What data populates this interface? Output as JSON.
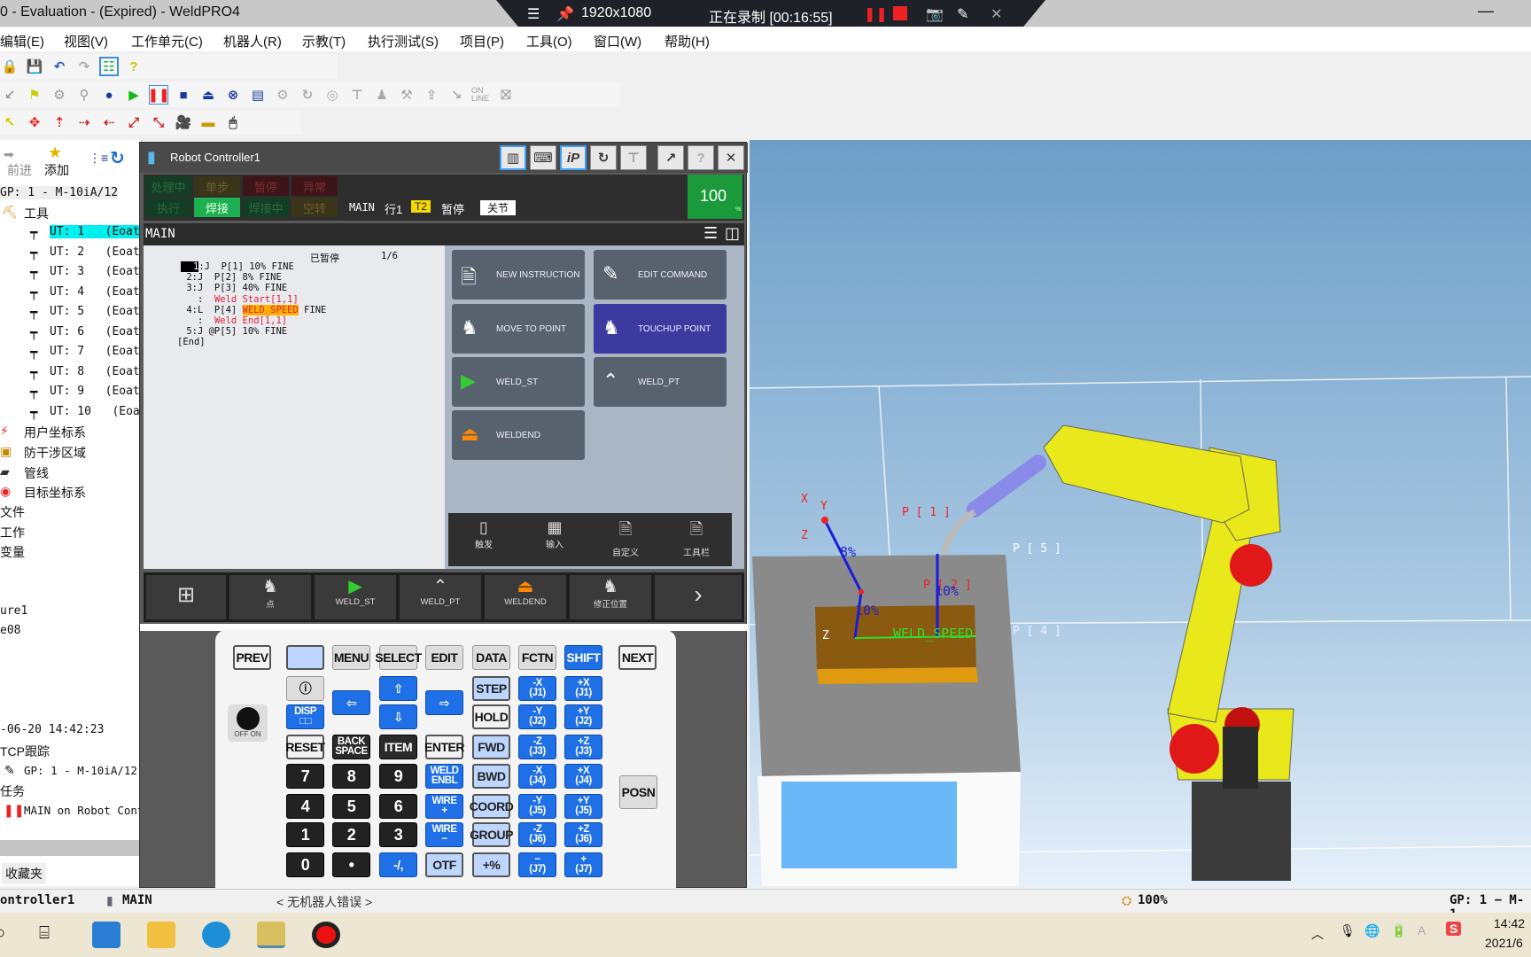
{
  "window": {
    "title": "0 - Evaluation - (Expired) - WeldPRO4",
    "minimize": "—"
  },
  "recorder": {
    "resolution": "1920x1080",
    "status": "正在录制 [00:16:55]"
  },
  "menu": [
    "编辑(E)",
    "视图(V)",
    "工作单元(C)",
    "机器人(R)",
    "示教(T)",
    "执行测试(S)",
    "项目(P)",
    "工具(O)",
    "窗口(W)",
    "帮助(H)"
  ],
  "toolbar": {
    "online_label": "ON LINE"
  },
  "left_panel": {
    "forward": "前进",
    "add": "添加",
    "group": "GP: 1 - M-10iA/12",
    "tools": "工具",
    "ut": [
      [
        "UT: 1",
        "(Eoat1"
      ],
      [
        "UT: 2",
        "(Eoat2"
      ],
      [
        "UT: 3",
        "(Eoat3"
      ],
      [
        "UT: 4",
        "(Eoat4"
      ],
      [
        "UT: 5",
        "(Eoat5"
      ],
      [
        "UT: 6",
        "(Eoat6"
      ],
      [
        "UT: 7",
        "(Eoat7"
      ],
      [
        "UT: 8",
        "(Eoat8"
      ],
      [
        "UT: 9",
        "(Eoat9"
      ],
      [
        "UT: 10",
        "(Eoat"
      ]
    ],
    "nodes": [
      "用户坐标系",
      "防干涉区域",
      "管线",
      "目标坐标系",
      "文件",
      "工作",
      "变量"
    ],
    "lower": [
      "ure1",
      "e08",
      "-06-20 14:42:23",
      "TCP跟踪",
      "GP: 1 - M-10iA/12 (Robot Con",
      "任务",
      "MAIN on Robot Controller1"
    ],
    "favorites_tab": "收藏夹"
  },
  "tp": {
    "title": "Robot Controller1",
    "leds_top": [
      "处理中",
      "单步",
      "暂停",
      "异常"
    ],
    "leds_bottom": [
      "执行",
      "焊接",
      "焊接中",
      "空转"
    ],
    "status_line": {
      "prog": "MAIN",
      "line": "行1",
      "mode": "T2",
      "state": "暂停",
      "coord": "关节"
    },
    "override": "100",
    "override_unit": "%",
    "screen_title": "MAIN",
    "paused": "已暂停",
    "position": "1/6",
    "program": [
      [
        {
          "t": "1",
          "c": "cur"
        },
        {
          "t": ":J  P[1] 10% FINE",
          "c": "n"
        }
      ],
      [
        {
          "t": " 2:J  P[2] 8% FINE",
          "c": "n"
        }
      ],
      [
        {
          "t": " 3:J  P[3] 40% FINE",
          "c": "n"
        }
      ],
      [
        {
          "t": "   :  ",
          "c": "n"
        },
        {
          "t": "Weld Start",
          "c": "r"
        },
        {
          "t": "[1,1]",
          "c": "r"
        }
      ],
      [
        {
          "t": " 4:L  P[4] ",
          "c": "n"
        },
        {
          "t": "WELD_SPEED",
          "c": "h"
        },
        {
          "t": " FINE",
          "c": "n"
        }
      ],
      [
        {
          "t": "   :  ",
          "c": "n"
        },
        {
          "t": "Weld End",
          "c": "r"
        },
        {
          "t": "[1,1]",
          "c": "r"
        }
      ],
      [
        {
          "t": " 5:J @P[5] 10% FINE",
          "c": "n"
        }
      ],
      [
        {
          "t": "[End]",
          "c": "n"
        }
      ]
    ],
    "instr_buttons": [
      "NEW INSTRUCTION",
      "EDIT COMMAND",
      "MOVE TO POINT",
      "TOUCHUP POINT",
      "WELD_ST",
      "WELD_PT",
      "WELDEND"
    ],
    "sub_tools": [
      "触发",
      "输入",
      "自定义",
      "工具栏"
    ],
    "func_bar": [
      "",
      "点",
      "WELD_ST",
      "WELD_PT",
      "WELDEND",
      "修正位置",
      ""
    ],
    "keypad_side": {
      "prev": "PREV",
      "next": "NEXT",
      "posn": "POSN",
      "switch": "OFF  ON"
    },
    "keys": [
      [
        [
          "",
          "lblue"
        ],
        [
          "MENU",
          "gray"
        ],
        [
          "SELECT",
          "gray"
        ],
        [
          "EDIT",
          "gray"
        ],
        [
          "DATA",
          "gray"
        ],
        [
          "FCTN",
          "gray"
        ],
        [
          "SHIFT",
          "blue"
        ]
      ],
      [
        [
          "ⓘ",
          "gray"
        ],
        [
          "⇦",
          "blue"
        ],
        [
          "⇧",
          "blue"
        ],
        [
          "⇨",
          "blue"
        ],
        [
          "STEP",
          "lblue"
        ],
        [
          "-X\n(J1)",
          "blue"
        ],
        [
          "+X\n(J1)",
          "blue"
        ]
      ],
      [
        [
          "DISP\n□□",
          "blue"
        ],
        null,
        [
          "⇩",
          "blue"
        ],
        null,
        [
          "HOLD",
          "white"
        ],
        [
          "-Y\n(J2)",
          "blue"
        ],
        [
          "+Y\n(J2)",
          "blue"
        ]
      ],
      [
        [
          "RESET",
          "white"
        ],
        [
          "BACK\nSPACE",
          "black"
        ],
        [
          "ITEM",
          "black"
        ],
        [
          "ENTER",
          "white"
        ],
        [
          "FWD",
          "lblue"
        ],
        [
          "-Z\n(J3)",
          "blue"
        ],
        [
          "+Z\n(J3)",
          "blue"
        ]
      ],
      [
        [
          "7",
          "num"
        ],
        [
          "8",
          "num"
        ],
        [
          "9",
          "num"
        ],
        [
          "WELD\nENBL",
          "blue"
        ],
        [
          "BWD",
          "lblue"
        ],
        [
          "-X\n(J4)",
          "blue"
        ],
        [
          "+X\n(J4)",
          "blue"
        ]
      ],
      [
        [
          "4",
          "num"
        ],
        [
          "5",
          "num"
        ],
        [
          "6",
          "num"
        ],
        [
          "WIRE\n+",
          "blue"
        ],
        [
          "COORD",
          "lblue"
        ],
        [
          "-Y\n(J5)",
          "blue"
        ],
        [
          "+Y\n(J5)",
          "blue"
        ]
      ],
      [
        [
          "1",
          "num"
        ],
        [
          "2",
          "num"
        ],
        [
          "3",
          "num"
        ],
        [
          "WIRE\n−",
          "blue"
        ],
        [
          "GROUP",
          "lblue"
        ],
        [
          "-Z\n(J6)",
          "blue"
        ],
        [
          "+Z\n(J6)",
          "blue"
        ]
      ],
      [
        [
          "0",
          "num"
        ],
        [
          "•",
          "num"
        ],
        [
          "-/,",
          "blue"
        ],
        [
          "OTF",
          "lblue"
        ],
        [
          "+%",
          "lblue"
        ],
        [
          "−\n(J7)",
          "blue"
        ],
        [
          "+\n(J7)",
          "blue"
        ]
      ]
    ]
  },
  "viewport": {
    "labels": {
      "p1": "P [ 1 ]",
      "p2": "P [ 2 ]",
      "p4": "P [ 4 ]",
      "p5": "P [ 5 ]",
      "s1": "8%",
      "s2": "10%",
      "s3": "10%",
      "weld": "WELD_SPEED",
      "x": "X",
      "y": "Y",
      "z": "Z"
    }
  },
  "statusbar": {
    "controller": "ontroller1",
    "program": "MAIN",
    "errors": "< 无机器人错误 >",
    "speed": "100%",
    "group": "GP: 1 − M-1"
  },
  "taskbar": {
    "time": "14:42",
    "date": "2021/6"
  },
  "colors": {
    "accent_blue": "#1f6fe6",
    "robot_yellow": "#e8e81a",
    "tp_selected": "#3c3a9e",
    "override_green": "#1a9a3a"
  }
}
